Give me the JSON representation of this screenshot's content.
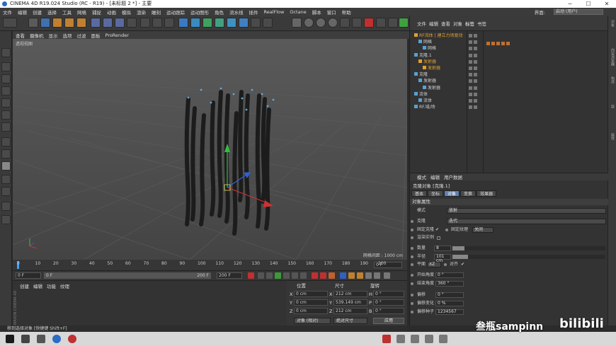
{
  "window": {
    "title": "CINEMA 4D R19.024 Studio (RC - R19) - [未标题 2 *] - 主要"
  },
  "menubar": {
    "items": [
      "文件",
      "编辑",
      "创建",
      "选择",
      "工具",
      "网格",
      "捕捉",
      "动画",
      "模拟",
      "渲染",
      "雕刻",
      "运动跟踪",
      "运动图形",
      "角色",
      "流水线",
      "插件",
      "RealFlow",
      "Octane",
      "脚本",
      "窗口",
      "帮助"
    ],
    "interface_label": "界面:",
    "interface_value": "启动 (用户)"
  },
  "viewport": {
    "menu": [
      "查看",
      "摄像机",
      "显示",
      "选项",
      "过滤",
      "面板",
      "ProRender"
    ],
    "label": "透视视图",
    "grid_spacing": "网格间距 : 1000 cm"
  },
  "timeline": {
    "ticks": [
      "0",
      "10",
      "20",
      "30",
      "40",
      "50",
      "60",
      "70",
      "80",
      "90",
      "100",
      "110",
      "120",
      "130",
      "140",
      "150",
      "160",
      "170",
      "180",
      "190",
      "200"
    ],
    "frame_display": "0 F",
    "start": "0 F",
    "range_start": "0 F",
    "range_end": "200 F",
    "end": "200 F"
  },
  "material": {
    "menu": [
      "创建",
      "编辑",
      "功能",
      "纹理"
    ],
    "brand": "MAXON CINEMA 4D"
  },
  "coords": {
    "headers": {
      "position": "位置",
      "size": "尺寸",
      "rotation": "旋转"
    },
    "rows": [
      {
        "axis": "X",
        "pos": "0 cm",
        "size_axis": "X",
        "size": "212 cm",
        "rot_axis": "H",
        "rot": "0 °"
      },
      {
        "axis": "Y",
        "pos": "0 cm",
        "size_axis": "Y",
        "size": "539.149 cm",
        "rot_axis": "P",
        "rot": "0 °"
      },
      {
        "axis": "Z",
        "pos": "0 cm",
        "size_axis": "Z",
        "size": "212 cm",
        "rot_axis": "B",
        "rot": "0 °"
      }
    ],
    "mode1": "对象 (相对)",
    "mode2": "绝对尺寸",
    "apply": "应用"
  },
  "statusbar": {
    "text": "移到选择对象 [快捷键 Shift+F]"
  },
  "objects": {
    "menu": [
      "文件",
      "编辑",
      "查看",
      "对象",
      "标签",
      "书签"
    ],
    "tree": [
      {
        "name": "RF流体 | 建立力场驱动",
        "indent": 0,
        "color": "#e0a030"
      },
      {
        "name": "网格",
        "indent": 1,
        "color": "#cfcfcf"
      },
      {
        "name": "网格",
        "indent": 2,
        "color": "#cfcfcf"
      },
      {
        "name": "克隆.1",
        "indent": 0,
        "color": "#cfcfcf"
      },
      {
        "name": "发射器",
        "indent": 1,
        "color": "#e0a030"
      },
      {
        "name": "发射器",
        "indent": 2,
        "color": "#e0a030"
      },
      {
        "name": "克隆",
        "indent": 0,
        "color": "#cfcfcf"
      },
      {
        "name": "发射器",
        "indent": 1,
        "color": "#cfcfcf"
      },
      {
        "name": "发射器",
        "indent": 2,
        "color": "#cfcfcf"
      },
      {
        "name": "流体",
        "indent": 0,
        "color": "#cfcfcf"
      },
      {
        "name": "流体",
        "indent": 1,
        "color": "#cfcfcf"
      },
      {
        "name": "RF.域/场",
        "indent": 0,
        "color": "#cfcfcf"
      }
    ]
  },
  "attributes": {
    "menu": [
      "模式",
      "编辑",
      "用户数据"
    ],
    "title": "克隆对象 [克隆.1]",
    "tabs": [
      "基本",
      "坐标",
      "对象",
      "变换",
      "效果器"
    ],
    "active_tab": "对象",
    "section": "对象属性",
    "mode_label": "模式",
    "mode_value": "放射",
    "clone_label": "克隆",
    "clone_value": "迭代",
    "fix_clone_label": "固定克隆",
    "fix_texture_label": "固定纹理",
    "fix_texture_value": "关闭",
    "render_instance_label": "渲染实例",
    "count_label": "数量",
    "count_value": "8",
    "count_fill": 0.08,
    "radius_label": "半径",
    "radius_value": "101 cm",
    "radius_fill": 0.1,
    "plane_label": "平面",
    "plane_value": "XZ",
    "align_label": "对齐",
    "start_angle_label": "开始角度",
    "start_angle_value": "0 °",
    "end_angle_label": "结束角度",
    "end_angle_value": "360 °",
    "offset_label": "偏移",
    "offset_value": "0 °",
    "offset_var_label": "偏移变化",
    "offset_var_value": "0 %",
    "offset_seed_label": "偏移种子",
    "offset_seed_value": "1234567"
  },
  "rightstrip": {
    "tabs": [
      "对象",
      "内容浏览器",
      "构造",
      "层",
      "属性"
    ]
  },
  "overlay": {
    "watermark": "叁瓶sampinn",
    "logo": "bilibili"
  }
}
